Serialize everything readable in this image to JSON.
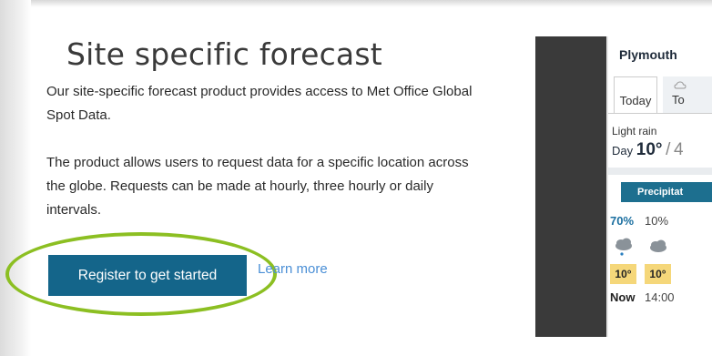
{
  "page": {
    "title": "Site specific forecast",
    "paragraph1": "Our site-specific forecast product provides access to Met Office Global Spot Data.",
    "paragraph2": "The product allows users to request data for a specific location across the globe. Requests can be made at hourly, three hourly or daily intervals.",
    "register_button": "Register to get started",
    "learn_more": "Learn more"
  },
  "colors": {
    "button": "#14658a",
    "highlight_ring": "#8cbf22",
    "link": "#4a8fd6"
  },
  "phone": {
    "location": "Plymouth",
    "tabs": [
      "Today",
      "To"
    ],
    "condition": "Light rain",
    "day_label": "Day",
    "day_temp": "10°",
    "night_temp_partial": "4",
    "precip_button": "Precipitat",
    "hours": [
      {
        "time": "Now",
        "precip": "70%",
        "temp": "10°",
        "icon": "cloud-rain-icon"
      },
      {
        "time": "14:00",
        "precip": "10%",
        "temp": "10°",
        "icon": "cloud-icon"
      }
    ]
  }
}
